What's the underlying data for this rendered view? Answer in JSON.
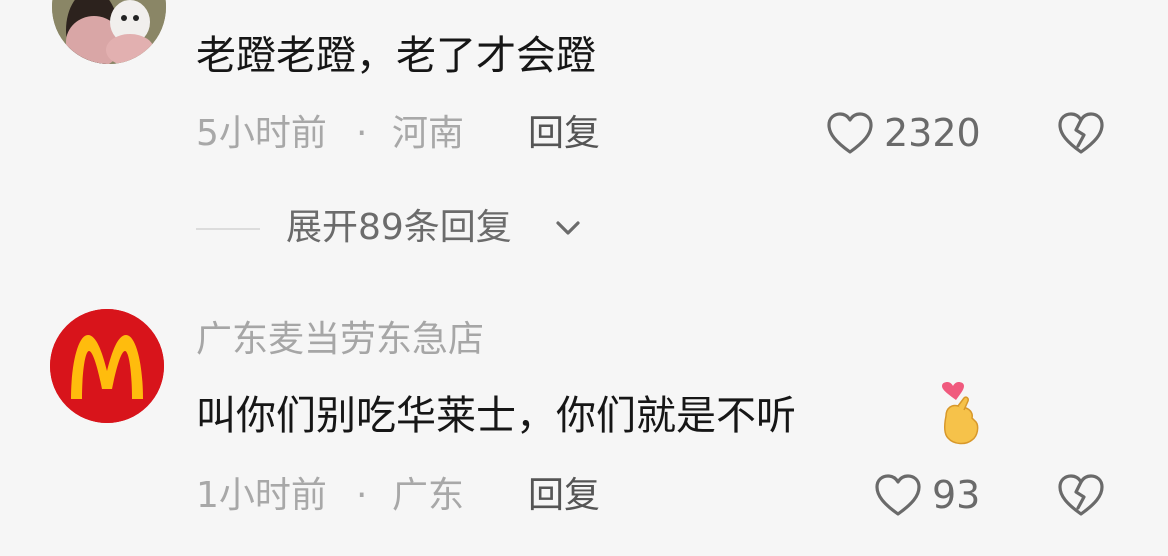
{
  "comments": [
    {
      "text": "老蹬老蹬，老了才会蹬",
      "time": "5小时前",
      "separator": "·",
      "location": "河南",
      "reply_label": "回复",
      "likes": "2320",
      "expand_label": "展开89条回复"
    },
    {
      "username": "广东麦当劳东急店",
      "text": "叫你们别吃华莱士，你们就是不听",
      "time": "1小时前",
      "separator": "·",
      "location": "广东",
      "reply_label": "回复",
      "likes": "93"
    }
  ],
  "colors": {
    "brand_red": "#d8141b",
    "brand_yellow": "#ffbc0d"
  },
  "icons": [
    "heart-icon",
    "broken-heart-icon",
    "chevron-down-icon",
    "heart-hands-emoji-icon"
  ]
}
